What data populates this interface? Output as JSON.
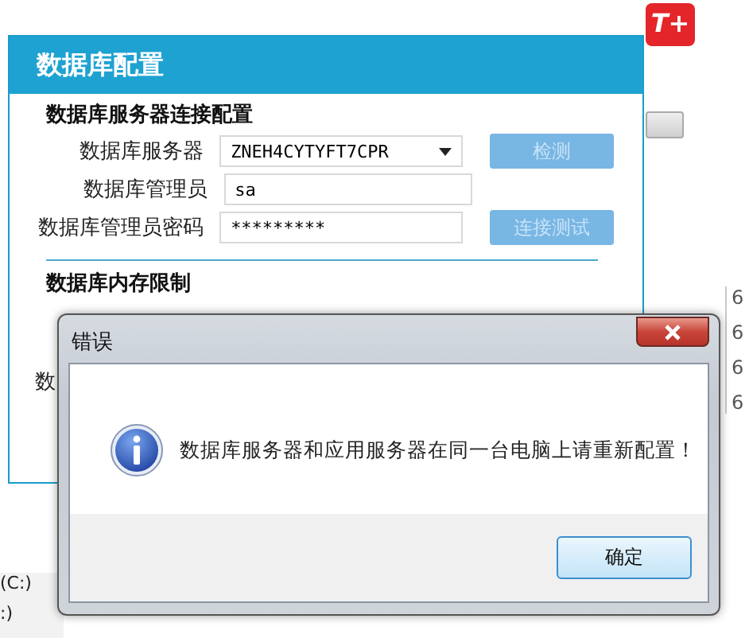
{
  "app_logo": {
    "text": "T+"
  },
  "config_dialog": {
    "title": "数据库配置",
    "section_connection": "数据库服务器连接配置",
    "fields": [
      {
        "label": "数据库服务器",
        "value": "ZNEH4CYTYFT7CPR",
        "kind": "dropdown",
        "button": {
          "label": "检测",
          "disabled": true
        }
      },
      {
        "label": "数据库管理员",
        "value": "sa",
        "kind": "text"
      },
      {
        "label": "数据库管理员密码",
        "value": "*********",
        "kind": "text",
        "button": {
          "label": "连接测试",
          "disabled": true
        }
      }
    ],
    "section_memory": "数据库内存限制",
    "partial_label": "数"
  },
  "error_dialog": {
    "title": "错误",
    "message": "数据库服务器和应用服务器在同一台电脑上请重新配置！",
    "button": "确定"
  },
  "background": {
    "right_column": [
      "6",
      "6",
      "6",
      "6"
    ],
    "drives": [
      "(C:)",
      ":)"
    ]
  }
}
